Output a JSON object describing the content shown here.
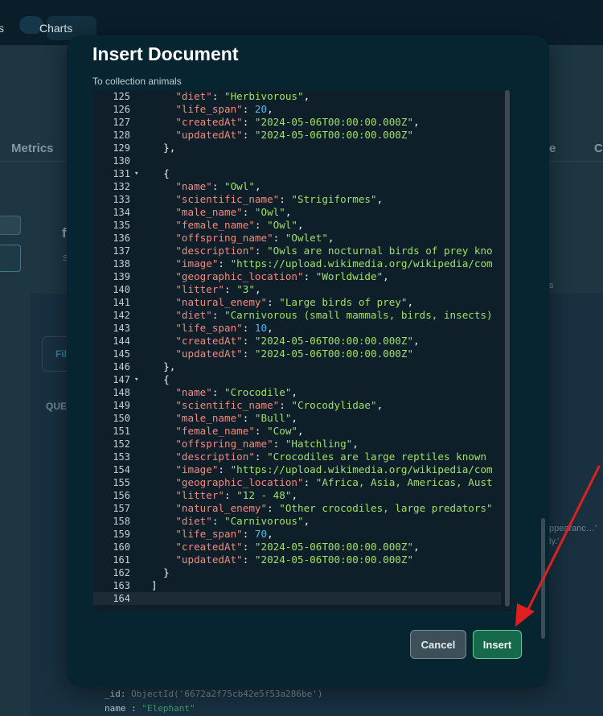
{
  "topbar": {
    "nav_partial": "s",
    "nav_charts": "Charts"
  },
  "background": {
    "tabs": [
      {
        "label": "Metrics"
      },
      {
        "label": "e"
      },
      {
        "label": "C"
      }
    ],
    "fil_label": "Fil",
    "query_label": "QUE",
    "heading_f": "f",
    "sub_s": "S",
    "right_s": "s",
    "right_faint_1": "ppearanc…'",
    "right_faint_2": "ly.'",
    "doc_id_key": "_id",
    "doc_id_val": "ObjectId('6672a2f75cb42e5f53a286be')",
    "doc_name_key": "name",
    "doc_name_val": "\"Elephant\""
  },
  "modal": {
    "title": "Insert Document",
    "subtitle": "To collection animals",
    "cancel_label": "Cancel",
    "insert_label": "Insert"
  },
  "editor": {
    "lines": [
      {
        "n": "125",
        "indent": 4,
        "tokens": [
          [
            "key",
            "\"diet\""
          ],
          [
            "punc",
            ": "
          ],
          [
            "str",
            "\"Herbivorous\""
          ],
          [
            "punc",
            ","
          ]
        ]
      },
      {
        "n": "126",
        "indent": 4,
        "tokens": [
          [
            "key",
            "\"life_span\""
          ],
          [
            "punc",
            ": "
          ],
          [
            "num",
            "20"
          ],
          [
            "punc",
            ","
          ]
        ]
      },
      {
        "n": "127",
        "indent": 4,
        "tokens": [
          [
            "key",
            "\"createdAt\""
          ],
          [
            "punc",
            ": "
          ],
          [
            "str",
            "\"2024-05-06T00:00:00.000Z\""
          ],
          [
            "punc",
            ","
          ]
        ]
      },
      {
        "n": "128",
        "indent": 4,
        "tokens": [
          [
            "key",
            "\"updatedAt\""
          ],
          [
            "punc",
            ": "
          ],
          [
            "str",
            "\"2024-05-06T00:00:00.000Z\""
          ]
        ]
      },
      {
        "n": "129",
        "indent": 2,
        "tokens": [
          [
            "punc",
            "},"
          ]
        ]
      },
      {
        "n": "130",
        "indent": 0,
        "tokens": []
      },
      {
        "n": "131",
        "indent": 2,
        "fold": true,
        "tokens": [
          [
            "punc",
            "{"
          ]
        ]
      },
      {
        "n": "132",
        "indent": 4,
        "tokens": [
          [
            "key",
            "\"name\""
          ],
          [
            "punc",
            ": "
          ],
          [
            "str",
            "\"Owl\""
          ],
          [
            "punc",
            ","
          ]
        ]
      },
      {
        "n": "133",
        "indent": 4,
        "tokens": [
          [
            "key",
            "\"scientific_name\""
          ],
          [
            "punc",
            ": "
          ],
          [
            "str",
            "\"Strigiformes\""
          ],
          [
            "punc",
            ","
          ]
        ]
      },
      {
        "n": "134",
        "indent": 4,
        "tokens": [
          [
            "key",
            "\"male_name\""
          ],
          [
            "punc",
            ": "
          ],
          [
            "str",
            "\"Owl\""
          ],
          [
            "punc",
            ","
          ]
        ]
      },
      {
        "n": "135",
        "indent": 4,
        "tokens": [
          [
            "key",
            "\"female_name\""
          ],
          [
            "punc",
            ": "
          ],
          [
            "str",
            "\"Owl\""
          ],
          [
            "punc",
            ","
          ]
        ]
      },
      {
        "n": "136",
        "indent": 4,
        "tokens": [
          [
            "key",
            "\"offspring_name\""
          ],
          [
            "punc",
            ": "
          ],
          [
            "str",
            "\"Owlet\""
          ],
          [
            "punc",
            ","
          ]
        ]
      },
      {
        "n": "137",
        "indent": 4,
        "tokens": [
          [
            "key",
            "\"description\""
          ],
          [
            "punc",
            ": "
          ],
          [
            "str",
            "\"Owls are nocturnal birds of prey kno"
          ]
        ]
      },
      {
        "n": "138",
        "indent": 4,
        "tokens": [
          [
            "key",
            "\"image\""
          ],
          [
            "punc",
            ": "
          ],
          [
            "str",
            "\"https://upload.wikimedia.org/wikipedia/com"
          ]
        ]
      },
      {
        "n": "139",
        "indent": 4,
        "tokens": [
          [
            "key",
            "\"geographic_location\""
          ],
          [
            "punc",
            ": "
          ],
          [
            "str",
            "\"Worldwide\""
          ],
          [
            "punc",
            ","
          ]
        ]
      },
      {
        "n": "140",
        "indent": 4,
        "tokens": [
          [
            "key",
            "\"litter\""
          ],
          [
            "punc",
            ": "
          ],
          [
            "str",
            "\"3\""
          ],
          [
            "punc",
            ","
          ]
        ]
      },
      {
        "n": "141",
        "indent": 4,
        "tokens": [
          [
            "key",
            "\"natural_enemy\""
          ],
          [
            "punc",
            ": "
          ],
          [
            "str",
            "\"Large birds of prey\""
          ],
          [
            "punc",
            ","
          ]
        ]
      },
      {
        "n": "142",
        "indent": 4,
        "tokens": [
          [
            "key",
            "\"diet\""
          ],
          [
            "punc",
            ": "
          ],
          [
            "str",
            "\"Carnivorous (small mammals, birds, insects)"
          ]
        ]
      },
      {
        "n": "143",
        "indent": 4,
        "tokens": [
          [
            "key",
            "\"life_span\""
          ],
          [
            "punc",
            ": "
          ],
          [
            "num",
            "10"
          ],
          [
            "punc",
            ","
          ]
        ]
      },
      {
        "n": "144",
        "indent": 4,
        "tokens": [
          [
            "key",
            "\"createdAt\""
          ],
          [
            "punc",
            ": "
          ],
          [
            "str",
            "\"2024-05-06T00:00:00.000Z\""
          ],
          [
            "punc",
            ","
          ]
        ]
      },
      {
        "n": "145",
        "indent": 4,
        "tokens": [
          [
            "key",
            "\"updatedAt\""
          ],
          [
            "punc",
            ": "
          ],
          [
            "str",
            "\"2024-05-06T00:00:00.000Z\""
          ]
        ]
      },
      {
        "n": "146",
        "indent": 2,
        "tokens": [
          [
            "punc",
            "},"
          ]
        ]
      },
      {
        "n": "147",
        "indent": 2,
        "fold": true,
        "tokens": [
          [
            "punc",
            "{"
          ]
        ]
      },
      {
        "n": "148",
        "indent": 4,
        "tokens": [
          [
            "key",
            "\"name\""
          ],
          [
            "punc",
            ": "
          ],
          [
            "str",
            "\"Crocodile\""
          ],
          [
            "punc",
            ","
          ]
        ]
      },
      {
        "n": "149",
        "indent": 4,
        "tokens": [
          [
            "key",
            "\"scientific_name\""
          ],
          [
            "punc",
            ": "
          ],
          [
            "str",
            "\"Crocodylidae\""
          ],
          [
            "punc",
            ","
          ]
        ]
      },
      {
        "n": "150",
        "indent": 4,
        "tokens": [
          [
            "key",
            "\"male_name\""
          ],
          [
            "punc",
            ": "
          ],
          [
            "str",
            "\"Bull\""
          ],
          [
            "punc",
            ","
          ]
        ]
      },
      {
        "n": "151",
        "indent": 4,
        "tokens": [
          [
            "key",
            "\"female_name\""
          ],
          [
            "punc",
            ": "
          ],
          [
            "str",
            "\"Cow\""
          ],
          [
            "punc",
            ","
          ]
        ]
      },
      {
        "n": "152",
        "indent": 4,
        "tokens": [
          [
            "key",
            "\"offspring_name\""
          ],
          [
            "punc",
            ": "
          ],
          [
            "str",
            "\"Hatchling\""
          ],
          [
            "punc",
            ","
          ]
        ]
      },
      {
        "n": "153",
        "indent": 4,
        "tokens": [
          [
            "key",
            "\"description\""
          ],
          [
            "punc",
            ": "
          ],
          [
            "str",
            "\"Crocodiles are large reptiles known "
          ]
        ]
      },
      {
        "n": "154",
        "indent": 4,
        "tokens": [
          [
            "key",
            "\"image\""
          ],
          [
            "punc",
            ": "
          ],
          [
            "str",
            "\"https://upload.wikimedia.org/wikipedia/com"
          ]
        ]
      },
      {
        "n": "155",
        "indent": 4,
        "tokens": [
          [
            "key",
            "\"geographic_location\""
          ],
          [
            "punc",
            ": "
          ],
          [
            "str",
            "\"Africa, Asia, Americas, Aust"
          ]
        ]
      },
      {
        "n": "156",
        "indent": 4,
        "tokens": [
          [
            "key",
            "\"litter\""
          ],
          [
            "punc",
            ": "
          ],
          [
            "str",
            "\"12 - 48\""
          ],
          [
            "punc",
            ","
          ]
        ]
      },
      {
        "n": "157",
        "indent": 4,
        "tokens": [
          [
            "key",
            "\"natural_enemy\""
          ],
          [
            "punc",
            ": "
          ],
          [
            "str",
            "\"Other crocodiles, large predators\""
          ]
        ]
      },
      {
        "n": "158",
        "indent": 4,
        "tokens": [
          [
            "key",
            "\"diet\""
          ],
          [
            "punc",
            ": "
          ],
          [
            "str",
            "\"Carnivorous\""
          ],
          [
            "punc",
            ","
          ]
        ]
      },
      {
        "n": "159",
        "indent": 4,
        "tokens": [
          [
            "key",
            "\"life_span\""
          ],
          [
            "punc",
            ": "
          ],
          [
            "num",
            "70"
          ],
          [
            "punc",
            ","
          ]
        ]
      },
      {
        "n": "160",
        "indent": 4,
        "tokens": [
          [
            "key",
            "\"createdAt\""
          ],
          [
            "punc",
            ": "
          ],
          [
            "str",
            "\"2024-05-06T00:00:00.000Z\""
          ],
          [
            "punc",
            ","
          ]
        ]
      },
      {
        "n": "161",
        "indent": 4,
        "tokens": [
          [
            "key",
            "\"updatedAt\""
          ],
          [
            "punc",
            ": "
          ],
          [
            "str",
            "\"2024-05-06T00:00:00.000Z\""
          ]
        ]
      },
      {
        "n": "162",
        "indent": 2,
        "tokens": [
          [
            "punc",
            "}"
          ]
        ]
      },
      {
        "n": "163",
        "indent": 0,
        "tokens": [
          [
            "punc",
            "]"
          ]
        ]
      },
      {
        "n": "164",
        "indent": 0,
        "active": true,
        "tokens": []
      }
    ]
  },
  "colors": {
    "modal_bg": "#072530",
    "editor_bg": "#0f1f2a",
    "key": "#f08a7d",
    "string": "#9fe067",
    "number": "#57b4e8",
    "insert_button": "#16694a",
    "annotation_arrow": "#e02020"
  }
}
